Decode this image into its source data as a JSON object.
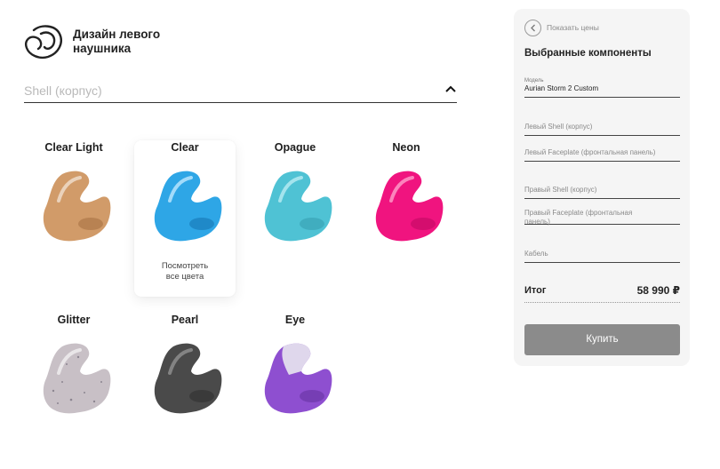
{
  "brand": {
    "title_line1": "Дизайн левого",
    "title_line2": "наушника",
    "logo_icon": "abstract-ear-logo-icon"
  },
  "dropdown": {
    "label": "Shell (корпус)",
    "icon": "chevron-up-icon"
  },
  "materials": [
    {
      "title": "Clear Light",
      "color": "#c98a4f"
    },
    {
      "title": "Clear",
      "color": "#2ea6e6",
      "selected": true,
      "link_line1": "Посмотреть",
      "link_line2": "все цвета"
    },
    {
      "title": "Opague",
      "color": "#4fc2d4"
    },
    {
      "title": "Neon",
      "color": "#f0147f"
    },
    {
      "title": "Glitter",
      "color": "#c8c0c6"
    },
    {
      "title": "Pearl",
      "color": "#4a4a4a"
    },
    {
      "title": "Eye",
      "color": "#8e4fd0"
    }
  ],
  "panel": {
    "show_prices": "Показать цены",
    "title": "Выбранные компоненты",
    "model_label": "Модель",
    "model_value": "Aurian Storm 2 Custom",
    "fields": [
      "Левый Shell (корпус)",
      "Левый Faceplate (фронтальная панель)",
      "Правый Shell (корпус)",
      "Правый Faceplate (фронтальная панель)",
      "Кабель"
    ],
    "total_label": "Итог",
    "total_value": "58 990 ₽",
    "buy_label": "Купить"
  },
  "colors": {
    "buy_button": "#8b8b8b",
    "panel_bg": "#f5f5f5"
  }
}
